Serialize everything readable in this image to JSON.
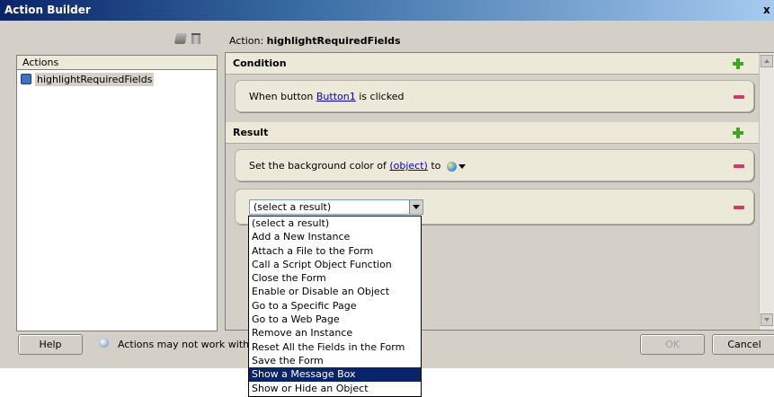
{
  "window": {
    "title": "Action Builder",
    "close_label": "x"
  },
  "actions_panel": {
    "header": "Actions",
    "items": [
      {
        "label": "highlightRequiredFields",
        "icon": "action-script-icon"
      }
    ]
  },
  "action_title": {
    "prefix": "Action: ",
    "name": "highlightRequiredFields"
  },
  "condition": {
    "header": "Condition",
    "text_before": "When button ",
    "link": "Button1",
    "text_after": " is clicked"
  },
  "result": {
    "header": "Result",
    "item1_before": "Set the background color of ",
    "item1_link": "(object)",
    "item1_after": " to",
    "select_value": "(select a result)"
  },
  "dropdown": {
    "options": [
      "(select a result)",
      "Add a New Instance",
      "Attach a File to the Form",
      "Call a Script Object Function",
      "Close the Form",
      "Enable or Disable an Object",
      "Go to a Specific Page",
      "Go to a Web Page",
      "Remove an Instance",
      "Reset All the Fields in the Form",
      "Save the Form",
      "Show a Message Box",
      "Show or Hide an Object"
    ],
    "selected_index": 11
  },
  "footer": {
    "help_label": "Help",
    "hint": "Actions may not work with form",
    "ok_label": "OK",
    "cancel_label": "Cancel"
  },
  "colors": {
    "accent": "#0a246a",
    "add": "#3ca81e",
    "remove": "#d6366b",
    "link": "#0000cc"
  }
}
